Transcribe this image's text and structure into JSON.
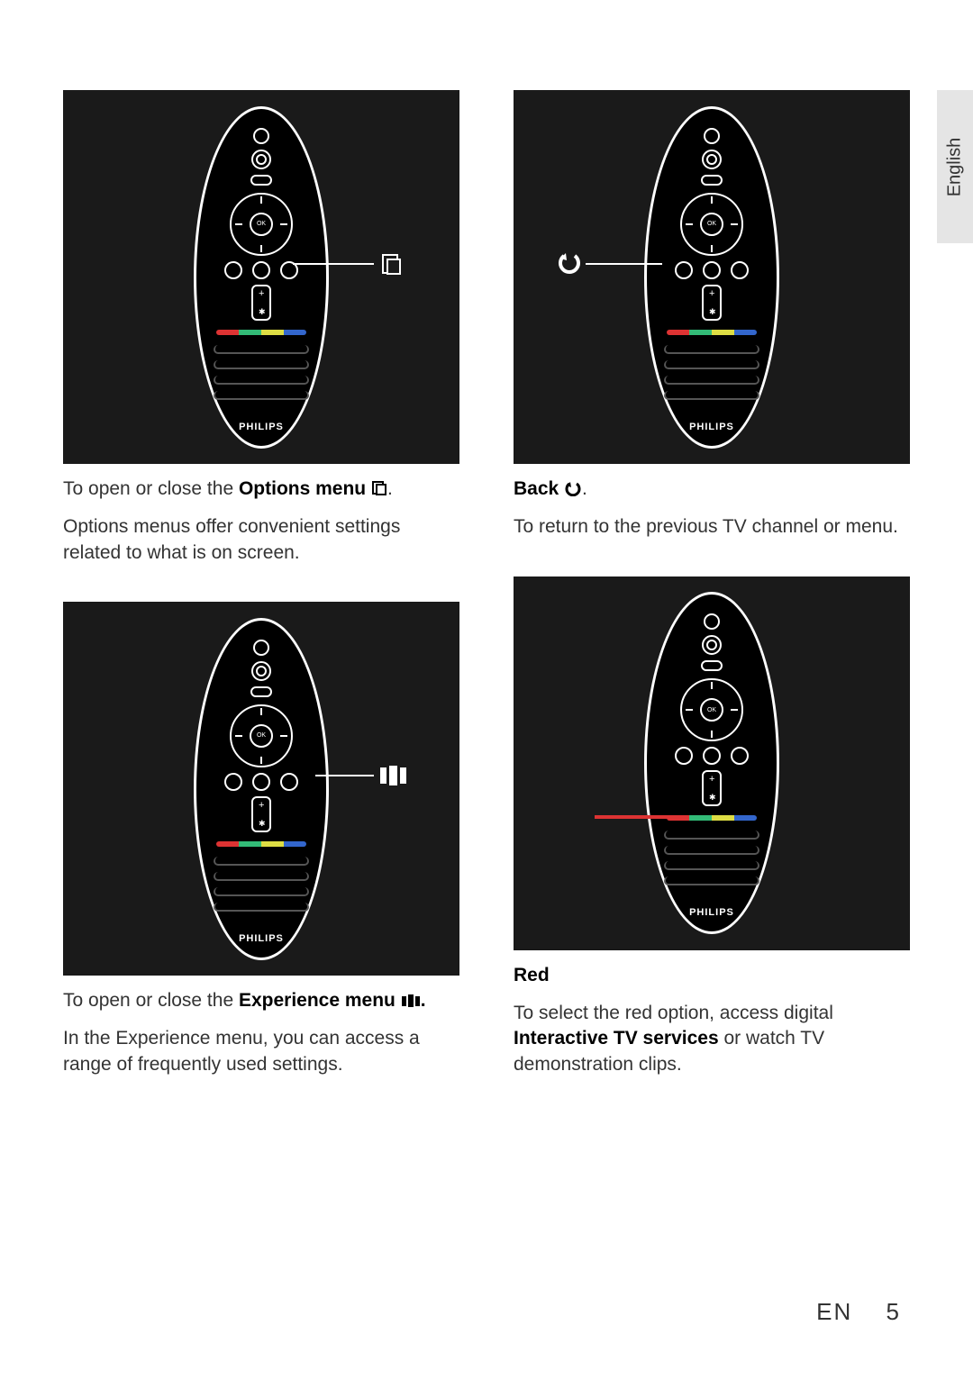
{
  "language_tab": "English",
  "footer": {
    "lang": "EN",
    "page": "5"
  },
  "remote_brand": "PHILIPS",
  "remote_ok": "OK",
  "sections": {
    "options": {
      "line_pre": "To open or close the ",
      "line_bold": "Options menu",
      "line_post": ".",
      "desc": "Options menus offer convenient settings related to what is on screen."
    },
    "experience": {
      "line_pre": "To open or close the ",
      "line_bold": "Experience menu",
      "line_post": ".",
      "desc": "In the Experience menu, you can access a range of frequently used settings."
    },
    "back": {
      "title": "Back",
      "title_post": ".",
      "desc": "To return to the previous TV channel or menu."
    },
    "red": {
      "title": "Red",
      "desc_pre": "To select the red option, access digital ",
      "desc_bold": "Interactive TV services",
      "desc_post": " or watch TV demonstration clips."
    }
  }
}
